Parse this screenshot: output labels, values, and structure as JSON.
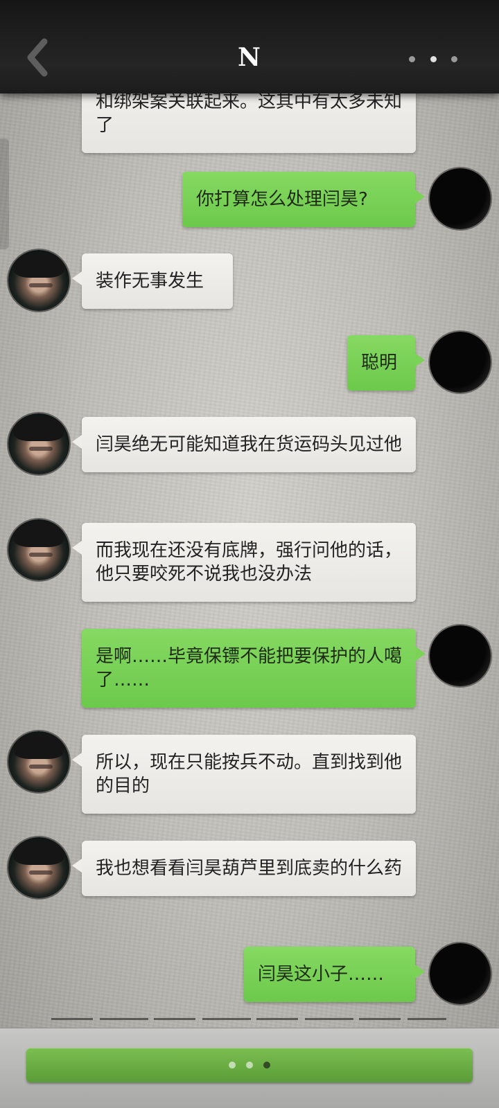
{
  "header": {
    "title": "N",
    "back_icon": "chevron-left-icon",
    "more_icon": "more-dots-icon"
  },
  "messages": [
    {
      "side": "in",
      "text": "和绑架案关联起来。这其中有太多未知了"
    },
    {
      "side": "out",
      "text": "你打算怎么处理闫昊?"
    },
    {
      "side": "in",
      "text": "装作无事发生"
    },
    {
      "side": "out",
      "text": "聪明"
    },
    {
      "side": "in",
      "text": "闫昊绝无可能知道我在货运码头见过他"
    },
    {
      "side": "in",
      "text": "而我现在还没有底牌，强行问他的话，他只要咬死不说我也没办法"
    },
    {
      "side": "out",
      "text": "是啊……毕竟保镖不能把要保护的人噶了……"
    },
    {
      "side": "in",
      "text": "所以，现在只能按兵不动。直到找到他的目的"
    },
    {
      "side": "in",
      "text": "我也想看看闫昊葫芦里到底卖的什么药"
    },
    {
      "side": "out",
      "text": "闫昊这小子……"
    }
  ],
  "footer": {
    "continue_icon": "loading-dots-icon"
  },
  "colors": {
    "header_bg": "#1f1f1f",
    "bubble_in": "#eceae7",
    "bubble_out": "#78cf55",
    "continue_button": "#6aae44"
  }
}
